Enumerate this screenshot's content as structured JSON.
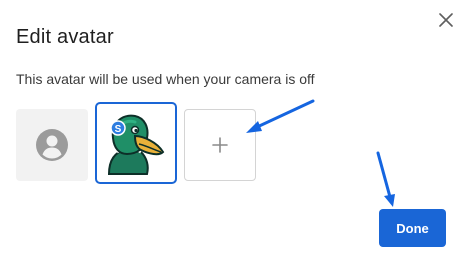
{
  "dialog": {
    "title": "Edit avatar",
    "subtitle": "This avatar will be used when your camera is off",
    "close_icon": "close-icon",
    "avatars": [
      {
        "kind": "default",
        "icon": "person-icon",
        "selected": false
      },
      {
        "kind": "duck",
        "icon": "duck-avatar-icon",
        "selected": true,
        "badge_letter": "S"
      },
      {
        "kind": "add",
        "icon": "plus-icon",
        "selected": false
      }
    ],
    "done_label": "Done"
  },
  "colors": {
    "accent": "#1a66d6",
    "tile_bg": "#f2f2f2",
    "annotation_arrow": "#1565e0"
  }
}
